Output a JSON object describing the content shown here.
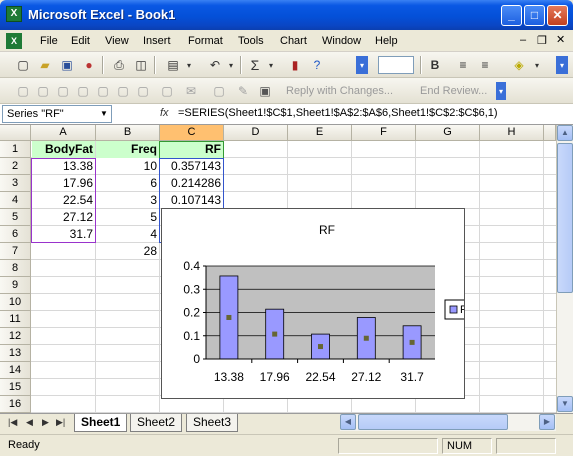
{
  "window": {
    "title": "Microsoft Excel - Book1"
  },
  "menu": [
    "File",
    "Edit",
    "View",
    "Insert",
    "Format",
    "Tools",
    "Chart",
    "Window",
    "Help"
  ],
  "toolbar2": {
    "reply_label": "Reply with Changes...",
    "end_review_label": "End Review..."
  },
  "formula_bar": {
    "name_box": "Series \"RF\"",
    "fx": "fx",
    "formula": "=SERIES(Sheet1!$C$1,Sheet1!$A$2:$A$6,Sheet1!$C$2:$C$6,1)"
  },
  "columns": [
    "A",
    "B",
    "C",
    "D",
    "E",
    "F",
    "G",
    "H"
  ],
  "rows": [
    "1",
    "2",
    "3",
    "4",
    "5",
    "6",
    "7",
    "8",
    "9",
    "10",
    "11",
    "12",
    "13",
    "14",
    "15",
    "16"
  ],
  "cells": {
    "A1": "BodyFat",
    "B1": "Freq",
    "C1": "RF",
    "A2": "13.38",
    "B2": "10",
    "C2": "0.357143",
    "A3": "17.96",
    "B3": "6",
    "C3": "0.214286",
    "A4": "22.54",
    "B4": "3",
    "C4": "0.107143",
    "A5": "27.12",
    "B5": "5",
    "A6": "31.7",
    "B6": "4",
    "B7": "28"
  },
  "chart_data": {
    "type": "bar",
    "title": "RF",
    "categories": [
      "13.38",
      "17.96",
      "22.54",
      "27.12",
      "31.7"
    ],
    "series": [
      {
        "name": "RF",
        "values": [
          0.357143,
          0.214286,
          0.107143,
          0.178571,
          0.142857
        ]
      }
    ],
    "ylim": [
      0,
      0.4
    ],
    "yticks": [
      "0",
      "0.1",
      "0.2",
      "0.3",
      "0.4"
    ],
    "grid": true,
    "legend": "right",
    "colors": {
      "bar": "#9999ff",
      "plot_bg": "#c0c0c0",
      "marker": "#666633"
    }
  },
  "sheets": [
    "Sheet1",
    "Sheet2",
    "Sheet3"
  ],
  "status": {
    "left": "Ready",
    "num": "NUM"
  }
}
